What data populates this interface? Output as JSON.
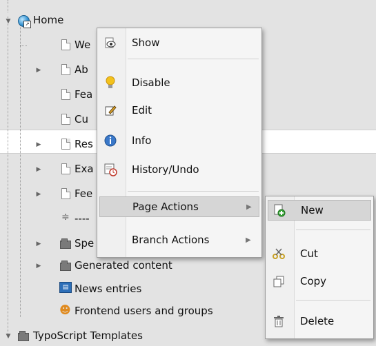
{
  "tree": {
    "rows": [
      {
        "label": "Home",
        "icon": "globe-icon"
      },
      {
        "label": "We",
        "icon": "page-icon"
      },
      {
        "label": "Ab",
        "icon": "page-icon"
      },
      {
        "label": "Fea",
        "icon": "page-icon"
      },
      {
        "label": "Cu",
        "icon": "page-icon"
      },
      {
        "label": "Res",
        "icon": "page-icon"
      },
      {
        "label": "Exa",
        "icon": "page-icon"
      },
      {
        "label": "Fee",
        "icon": "page-icon"
      },
      {
        "label": "----",
        "icon": "separator-icon"
      },
      {
        "label": "Spe",
        "icon": "folder-icon"
      },
      {
        "label": "Generated content",
        "icon": "folder-icon"
      },
      {
        "label": "News entries",
        "icon": "news-icon"
      },
      {
        "label": "Frontend users and groups",
        "icon": "users-icon"
      },
      {
        "label": "TypoScript Templates",
        "icon": "folder-icon"
      }
    ]
  },
  "context_menu": {
    "items": [
      {
        "label": "Show",
        "icon": "eye-icon"
      },
      {
        "label": "Disable",
        "icon": "lightbulb-icon"
      },
      {
        "label": "Edit",
        "icon": "pencil-icon"
      },
      {
        "label": "Info",
        "icon": "info-icon"
      },
      {
        "label": "History/Undo",
        "icon": "history-icon"
      },
      {
        "label": "Page Actions",
        "icon": ""
      },
      {
        "label": "Branch Actions",
        "icon": ""
      }
    ]
  },
  "submenu": {
    "items": [
      {
        "label": "New",
        "icon": "new-page-icon"
      },
      {
        "label": "Cut",
        "icon": "scissors-icon"
      },
      {
        "label": "Copy",
        "icon": "copy-icon"
      },
      {
        "label": "Delete",
        "icon": "trash-icon"
      }
    ]
  }
}
